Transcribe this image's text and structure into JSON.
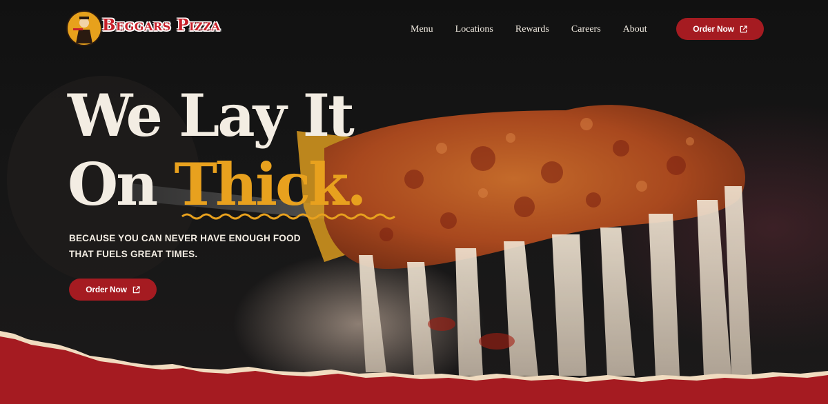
{
  "brand": {
    "name": "Beggars Pizza",
    "colors": {
      "accent_red": "#a51b21",
      "accent_gold": "#e8a11e",
      "cream": "#f3ede3",
      "background": "#141414"
    }
  },
  "nav": {
    "links": [
      "Menu",
      "Locations",
      "Rewards",
      "Careers",
      "About"
    ],
    "cta_label": "Order Now"
  },
  "hero": {
    "headline_line1": "We Lay It",
    "headline_line2_prefix": "On ",
    "headline_line2_accent": "Thick.",
    "tagline": "Because you can never have enough food that fuels great times.",
    "cta_label": "Order Now"
  },
  "icons": {
    "external_link": "external-link-icon",
    "logo_mascot": "mascot-icon"
  }
}
